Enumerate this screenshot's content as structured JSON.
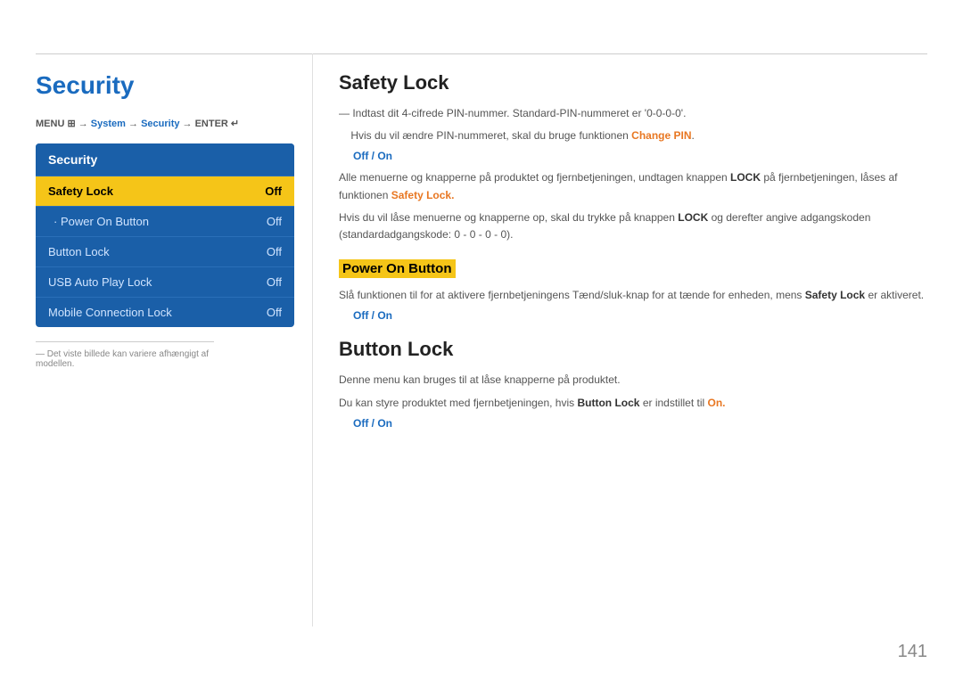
{
  "top_line": true,
  "page_number": "141",
  "left": {
    "title": "Security",
    "breadcrumb": {
      "menu": "MENU",
      "menu_icon": "⊞",
      "arrow": "→",
      "system": "System",
      "security": "Security",
      "enter": "ENTER",
      "enter_icon": "↵"
    },
    "menu_header": "Security",
    "menu_items": [
      {
        "label": "Safety Lock",
        "value": "Off",
        "active": true,
        "sub": false
      },
      {
        "label": "· Power On Button",
        "value": "Off",
        "active": false,
        "sub": true
      },
      {
        "label": "Button Lock",
        "value": "Off",
        "active": false,
        "sub": false
      },
      {
        "label": "USB Auto Play Lock",
        "value": "Off",
        "active": false,
        "sub": false
      },
      {
        "label": "Mobile Connection Lock",
        "value": "Off",
        "active": false,
        "sub": false
      }
    ],
    "footnote": "— Det viste billede kan variere afhængigt af modellen."
  },
  "main": {
    "safety_lock": {
      "title": "Safety Lock",
      "pin_info_1": "Indtast dit 4-cifrede PIN-nummer. Standard-PIN-nummeret er '0-0-0-0'.",
      "pin_info_2": "Hvis du vil ændre PIN-nummeret, skal du bruge funktionen",
      "pin_info_2_link": "Change PIN",
      "bullet_off_on": "Off / On",
      "desc_1_pre": "Alle menuerne og knapperne på produktet og fjernbetjeningen, undtagen knappen",
      "desc_1_bold": "LOCK",
      "desc_1_post": "på fjernbetjeningen, låses af funktionen",
      "desc_1_link": "Safety Lock.",
      "desc_2_pre": "Hvis du vil låse menuerne og knapperne op, skal du trykke på knappen",
      "desc_2_bold": "LOCK",
      "desc_2_post": "og derefter angive adgangskoden (standardadgangskode: 0 - 0 - 0 - 0)."
    },
    "power_on_button": {
      "subtitle": "Power On Button",
      "desc": "Slå funktionen til for at aktivere fjernbetjeningens Tænd/sluk-knap for at tænde for enheden, mens",
      "desc_link": "Safety Lock",
      "desc_post": "er aktiveret.",
      "bullet_off_on": "Off / On"
    },
    "button_lock": {
      "title": "Button Lock",
      "desc_1": "Denne menu kan bruges til at låse knapperne på produktet.",
      "desc_2_pre": "Du kan styre produktet med fjernbetjeningen, hvis",
      "desc_2_bold": "Button Lock",
      "desc_2_post": "er indstillet til",
      "desc_2_link": "On.",
      "bullet_off_on": "Off / On"
    }
  }
}
